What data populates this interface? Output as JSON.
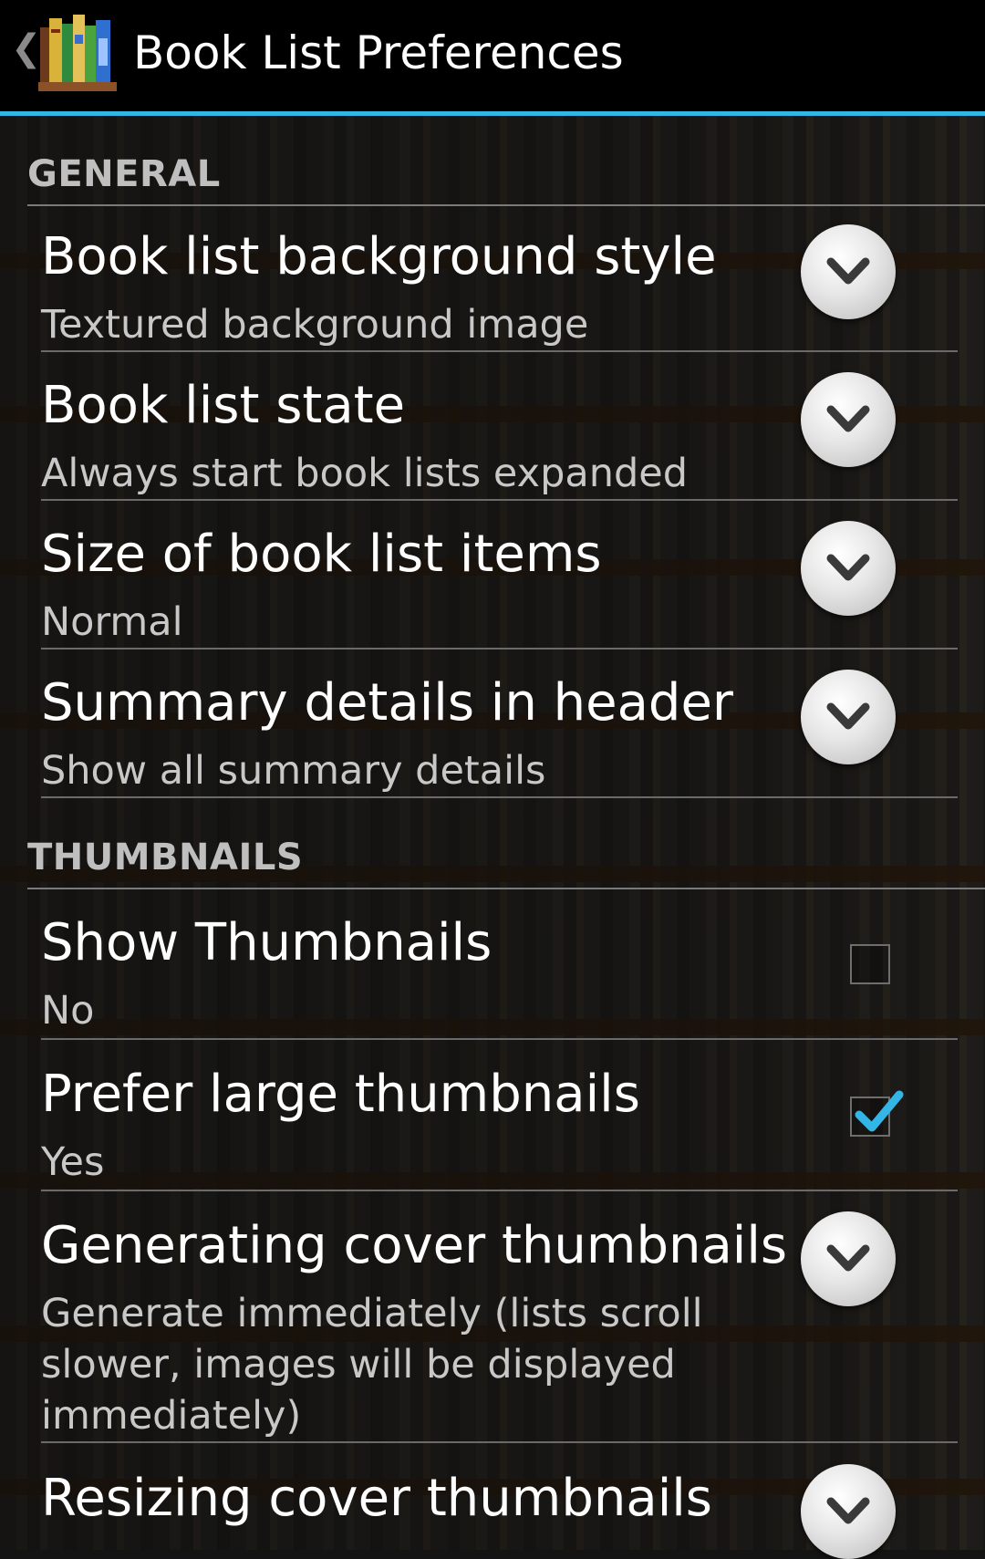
{
  "action_bar": {
    "up_glyph": "❮",
    "app_icon": "bookshelf-icon",
    "title": "Book List Preferences",
    "accent_color": "#33b5e5"
  },
  "sections": {
    "general": {
      "header": "GENERAL",
      "items": [
        {
          "title": "Book list background style",
          "summary": "Textured background image",
          "control": "dropdown"
        },
        {
          "title": "Book list state",
          "summary": "Always start book lists expanded",
          "control": "dropdown"
        },
        {
          "title": "Size of book list items",
          "summary": "Normal",
          "control": "dropdown"
        },
        {
          "title": "Summary details in header",
          "summary": "Show all summary details",
          "control": "dropdown"
        }
      ]
    },
    "thumbnails": {
      "header": "THUMBNAILS",
      "items": [
        {
          "title": "Show Thumbnails",
          "summary": "No",
          "control": "checkbox",
          "checked": false
        },
        {
          "title": "Prefer large thumbnails",
          "summary": "Yes",
          "control": "checkbox",
          "checked": true
        },
        {
          "title": "Generating cover thumbnails",
          "summary": "Generate immediately (lists scroll slower, images will be displayed immediately)",
          "control": "dropdown"
        },
        {
          "title": "Resizing cover thumbnails",
          "summary": "",
          "control": "dropdown"
        }
      ]
    }
  }
}
